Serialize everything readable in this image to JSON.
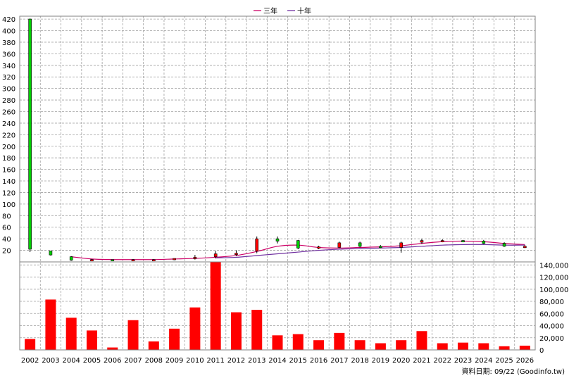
{
  "legend": [
    {
      "name": "三年",
      "color": "#cc0066"
    },
    {
      "name": "十年",
      "color": "#7030a0"
    }
  ],
  "footer_text": "資料日期: 09/22 (Goodinfo.tw)",
  "colors": {
    "up": "#ff0000",
    "down": "#00cc00",
    "volume": "#ff0000",
    "grid": "#a0a0a0"
  },
  "chart_data": [
    {
      "type": "candlestick",
      "years": [
        "2002",
        "2003",
        "2004",
        "2005",
        "2006",
        "2007",
        "2008",
        "2009",
        "2010",
        "2011",
        "2012",
        "2013",
        "2014",
        "2015",
        "2016",
        "2017",
        "2018",
        "2019",
        "2020",
        "2021",
        "2022",
        "2023",
        "2024",
        "2025",
        "2026"
      ],
      "yticks": [
        20,
        40,
        60,
        80,
        100,
        120,
        140,
        160,
        180,
        200,
        220,
        240,
        260,
        280,
        300,
        320,
        340,
        360,
        380,
        400,
        420
      ],
      "ylim": [
        0,
        425
      ],
      "candles": [
        {
          "year": "2002",
          "open": 420,
          "high": 421,
          "low": 17,
          "close": 22
        },
        {
          "year": "2003",
          "open": 19,
          "high": 19,
          "low": 11,
          "close": 12
        },
        {
          "year": "2004",
          "open": 9,
          "high": 10,
          "low": 2,
          "close": 3
        },
        {
          "year": "2005",
          "open": 4,
          "high": 5,
          "low": 3,
          "close": 4
        },
        {
          "year": "2006",
          "open": 4,
          "high": 4,
          "low": 3,
          "close": 3
        },
        {
          "year": "2007",
          "open": 4,
          "high": 5,
          "low": 3,
          "close": 4
        },
        {
          "year": "2008",
          "open": 4,
          "high": 5,
          "low": 3,
          "close": 4
        },
        {
          "year": "2009",
          "open": 4,
          "high": 6,
          "low": 3,
          "close": 6
        },
        {
          "year": "2010",
          "open": 6,
          "high": 12,
          "low": 4,
          "close": 8
        },
        {
          "year": "2011",
          "open": 9,
          "high": 19,
          "low": 6,
          "close": 14
        },
        {
          "year": "2012",
          "open": 13,
          "high": 20,
          "low": 10,
          "close": 15
        },
        {
          "year": "2013",
          "open": 19,
          "high": 44,
          "low": 15,
          "close": 40
        },
        {
          "year": "2014",
          "open": 40,
          "high": 44,
          "low": 32,
          "close": 36
        },
        {
          "year": "2015",
          "open": 37,
          "high": 38,
          "low": 22,
          "close": 24
        },
        {
          "year": "2016",
          "open": 24,
          "high": 28,
          "low": 22,
          "close": 26
        },
        {
          "year": "2017",
          "open": 25,
          "high": 35,
          "low": 24,
          "close": 33
        },
        {
          "year": "2018",
          "open": 33,
          "high": 35,
          "low": 25,
          "close": 27
        },
        {
          "year": "2019",
          "open": 27,
          "high": 29,
          "low": 24,
          "close": 26
        },
        {
          "year": "2020",
          "open": 25,
          "high": 35,
          "low": 16,
          "close": 33
        },
        {
          "year": "2021",
          "open": 34,
          "high": 40,
          "low": 31,
          "close": 37
        },
        {
          "year": "2022",
          "open": 36,
          "high": 39,
          "low": 34,
          "close": 37
        },
        {
          "year": "2023",
          "open": 37,
          "high": 38,
          "low": 34,
          "close": 36
        },
        {
          "year": "2024",
          "open": 36,
          "high": 38,
          "low": 31,
          "close": 32
        },
        {
          "year": "2025",
          "open": 32,
          "high": 34,
          "low": 26,
          "close": 27
        },
        {
          "year": "2026",
          "open": 27,
          "high": 29,
          "low": 24,
          "close": 27
        }
      ],
      "series": [
        {
          "name": "三年",
          "x": [
            "2004",
            "2005",
            "2006",
            "2007",
            "2008",
            "2009",
            "2010",
            "2011",
            "2012",
            "2013",
            "2014",
            "2015",
            "2016",
            "2017",
            "2018",
            "2019",
            "2020",
            "2021",
            "2022",
            "2023",
            "2024",
            "2025",
            "2026"
          ],
          "values": [
            9,
            5,
            4,
            4,
            4,
            5,
            6,
            8,
            11,
            18,
            27,
            29,
            25,
            24,
            25,
            26,
            28,
            32,
            35,
            36,
            35,
            32,
            30
          ]
        },
        {
          "name": "十年",
          "x": [
            "2011",
            "2012",
            "2013",
            "2014",
            "2015",
            "2016",
            "2017",
            "2018",
            "2019",
            "2020",
            "2021",
            "2022",
            "2023",
            "2024",
            "2025",
            "2026"
          ],
          "values": [
            7,
            8,
            11,
            14,
            17,
            20,
            22,
            23,
            24,
            25,
            27,
            29,
            30,
            30,
            29,
            29
          ]
        }
      ],
      "grid": true
    },
    {
      "type": "bar",
      "categories": [
        "2002",
        "2003",
        "2004",
        "2005",
        "2006",
        "2007",
        "2008",
        "2009",
        "2010",
        "2011",
        "2012",
        "2013",
        "2014",
        "2015",
        "2016",
        "2017",
        "2018",
        "2019",
        "2020",
        "2021",
        "2022",
        "2023",
        "2024",
        "2025",
        "2026"
      ],
      "values": [
        18000,
        83000,
        53000,
        32000,
        4000,
        49000,
        14000,
        35000,
        70000,
        145000,
        62000,
        66000,
        24000,
        26000,
        16000,
        28000,
        16000,
        11000,
        16000,
        31000,
        11000,
        12000,
        11000,
        6000,
        7000
      ],
      "yticks": [
        "0",
        "20,000",
        "40,000",
        "60,000",
        "80,000",
        "100,000",
        "120,000",
        "140,000"
      ],
      "ylim": [
        0,
        145000
      ],
      "grid": true
    }
  ]
}
